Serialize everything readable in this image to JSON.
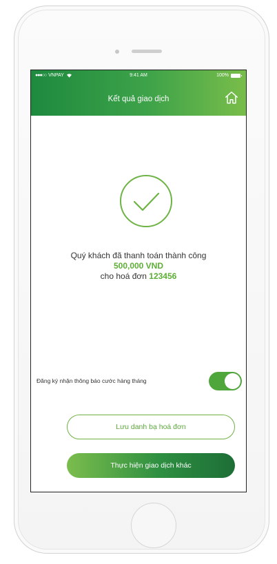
{
  "status_bar": {
    "carrier": "VNPAY",
    "time": "9:41 AM",
    "battery": "100%"
  },
  "header": {
    "title": "Kết quả giao dịch",
    "home_icon": "home-icon"
  },
  "result": {
    "message": "Quý khách đã thanh toán thành công",
    "amount": "500,000 VND",
    "bill_prefix": "cho hoá đơn ",
    "bill_id": "123456",
    "status_icon": "check-circle-icon"
  },
  "notification": {
    "label": "Đăng ký nhận thông báo cước hàng tháng",
    "enabled": true
  },
  "actions": {
    "save_contact_label": "Lưu danh bạ hoá đơn",
    "new_transaction_label": "Thực hiện giao dịch khác"
  },
  "colors": {
    "accent_green": "#5cae35",
    "header_dark": "#1e8a3f",
    "header_light": "#79bd4a"
  }
}
